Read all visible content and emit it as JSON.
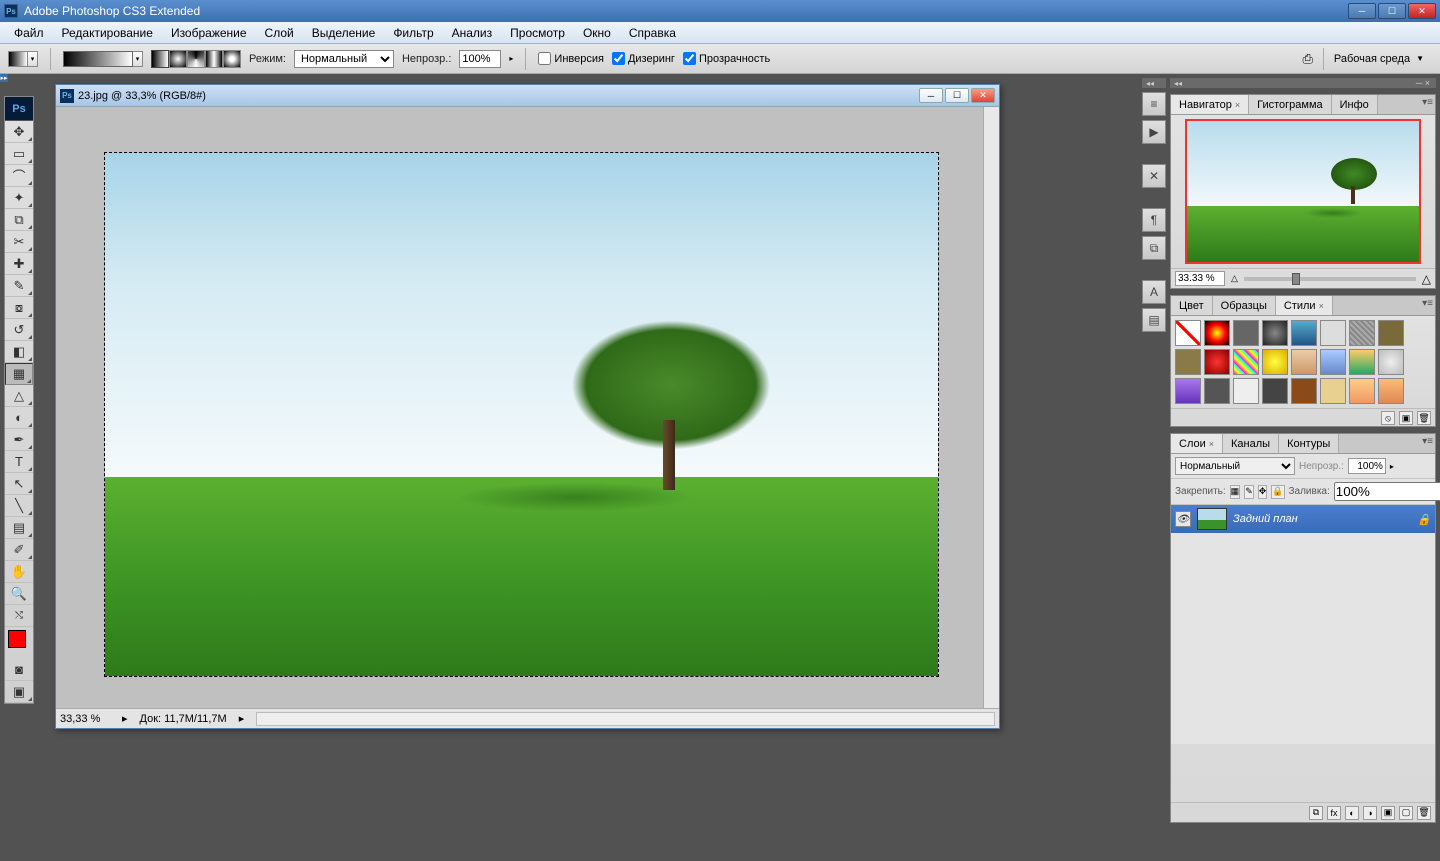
{
  "app": {
    "title": "Adobe Photoshop CS3 Extended"
  },
  "menu": {
    "file": "Файл",
    "edit": "Редактирование",
    "image": "Изображение",
    "layer": "Слой",
    "select": "Выделение",
    "filter": "Фильтр",
    "analysis": "Анализ",
    "view": "Просмотр",
    "window": "Окно",
    "help": "Справка"
  },
  "options": {
    "mode_label": "Режим:",
    "mode_value": "Нормальный",
    "opacity_label": "Непрозр.:",
    "opacity_value": "100%",
    "reverse_label": "Инверсия",
    "dither_label": "Дизеринг",
    "transparency_label": "Прозрачность",
    "workspace_label": "Рабочая среда"
  },
  "document": {
    "title": "23.jpg @ 33,3% (RGB/8#)",
    "zoom": "33,33 %",
    "docinfo": "Док: 11,7M/11,7M"
  },
  "panels": {
    "navigator": {
      "tab_navigator": "Навигатор",
      "tab_histogram": "Гистограмма",
      "tab_info": "Инфо",
      "zoom": "33.33 %"
    },
    "styles": {
      "tab_color": "Цвет",
      "tab_swatches": "Образцы",
      "tab_styles": "Стили"
    },
    "layers": {
      "tab_layers": "Слои",
      "tab_channels": "Каналы",
      "tab_paths": "Контуры",
      "blend_mode": "Нормальный",
      "opacity_label": "Непрозр.:",
      "opacity_value": "100%",
      "lock_label": "Закрепить:",
      "fill_label": "Заливка:",
      "fill_value": "100%",
      "layer0_name": "Задний план"
    }
  },
  "style_colors": [
    "linear-gradient(#fff,#fff)",
    "radial-gradient(#ff0,#f00,#000)",
    "#666",
    "radial-gradient(#888,#222)",
    "linear-gradient(#5ac,#258)",
    "#ddd",
    "repeating-linear-gradient(45deg,#888,#888 2px,#aaa 2px,#aaa 4px)",
    "#7a6a3a",
    "#8a7a4a",
    "radial-gradient(#f33,#800)",
    "repeating-linear-gradient(45deg,#f0f,#ff0 4px,#0ff 8px)",
    "radial-gradient(#ff4,#da0)",
    "linear-gradient(#eca,#c96)",
    "linear-gradient(#acf,#68c)",
    "linear-gradient(#fc6,#2a6)",
    "radial-gradient(#eee,#bbb)",
    "linear-gradient(#a7e,#63b)",
    "#555",
    "#eee",
    "#444",
    "#8a4a1a",
    "#e8d090",
    "linear-gradient(#fc8,#e96)",
    "linear-gradient(#fb7,#d85)"
  ]
}
